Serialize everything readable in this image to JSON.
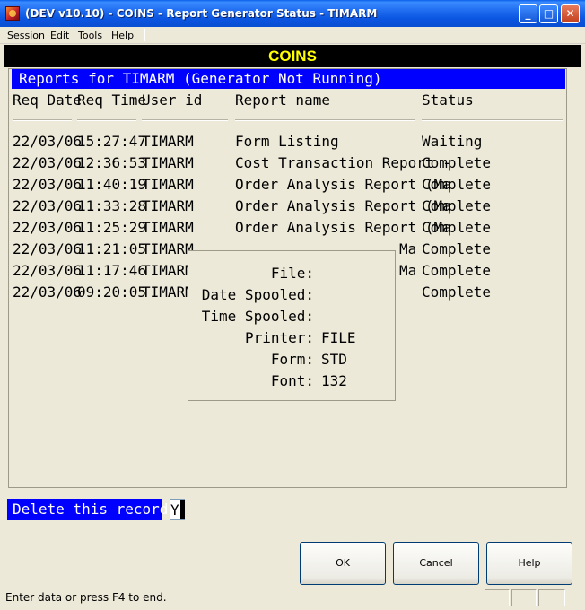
{
  "window": {
    "title": "(DEV v10.10) - COINS - Report Generator Status - TIMARM",
    "min_glyph": "_",
    "max_glyph": "□",
    "close_glyph": "✕"
  },
  "menu": [
    "Session",
    "Edit",
    "Tools",
    "Help"
  ],
  "app_header": "COINS",
  "section_title": "Reports for TIMARM (Generator Not Running)",
  "columns": [
    "Req Date",
    "Req Time",
    "User id",
    "Report name",
    "Status"
  ],
  "rows": [
    {
      "date": "22/03/06",
      "time": "15:27:47",
      "user": "TIMARM",
      "report": "Form Listing",
      "status": "Waiting"
    },
    {
      "date": "22/03/06",
      "time": "12:36:53",
      "user": "TIMARM",
      "report": "Cost Transaction Report -",
      "status": "Complete"
    },
    {
      "date": "22/03/06",
      "time": "11:40:19",
      "user": "TIMARM",
      "report": "Order Analysis Report (Ma",
      "status": "Complete"
    },
    {
      "date": "22/03/06",
      "time": "11:33:28",
      "user": "TIMARM",
      "report": "Order Analysis Report (Ma",
      "status": "Complete"
    },
    {
      "date": "22/03/06",
      "time": "11:25:29",
      "user": "TIMARM",
      "report": "Order Analysis Report (Ma",
      "status": "Complete"
    },
    {
      "date": "22/03/06",
      "time": "11:21:05",
      "user": "TIMARM",
      "report": "Ma",
      "status": "Complete"
    },
    {
      "date": "22/03/06",
      "time": "11:17:46",
      "user": "TIMARM",
      "report": "Ma",
      "status": "Complete"
    },
    {
      "date": "22/03/06",
      "time": "09:20:05",
      "user": "TIMARM",
      "report": "",
      "status": "Complete"
    }
  ],
  "details": {
    "file_label": "File:",
    "file_value": "",
    "date_spooled_label": "Date Spooled:",
    "date_spooled_value": "",
    "time_spooled_label": "Time Spooled:",
    "time_spooled_value": "",
    "printer_label": "Printer:",
    "printer_value": "FILE",
    "form_label": "Form:",
    "form_value": "STD",
    "font_label": "Font:",
    "font_value": "132"
  },
  "prompt": {
    "label": "Delete this record :",
    "value": "Y"
  },
  "buttons": {
    "ok": "OK",
    "cancel": "Cancel",
    "help": "Help"
  },
  "status_text": "Enter data or press F4 to end."
}
